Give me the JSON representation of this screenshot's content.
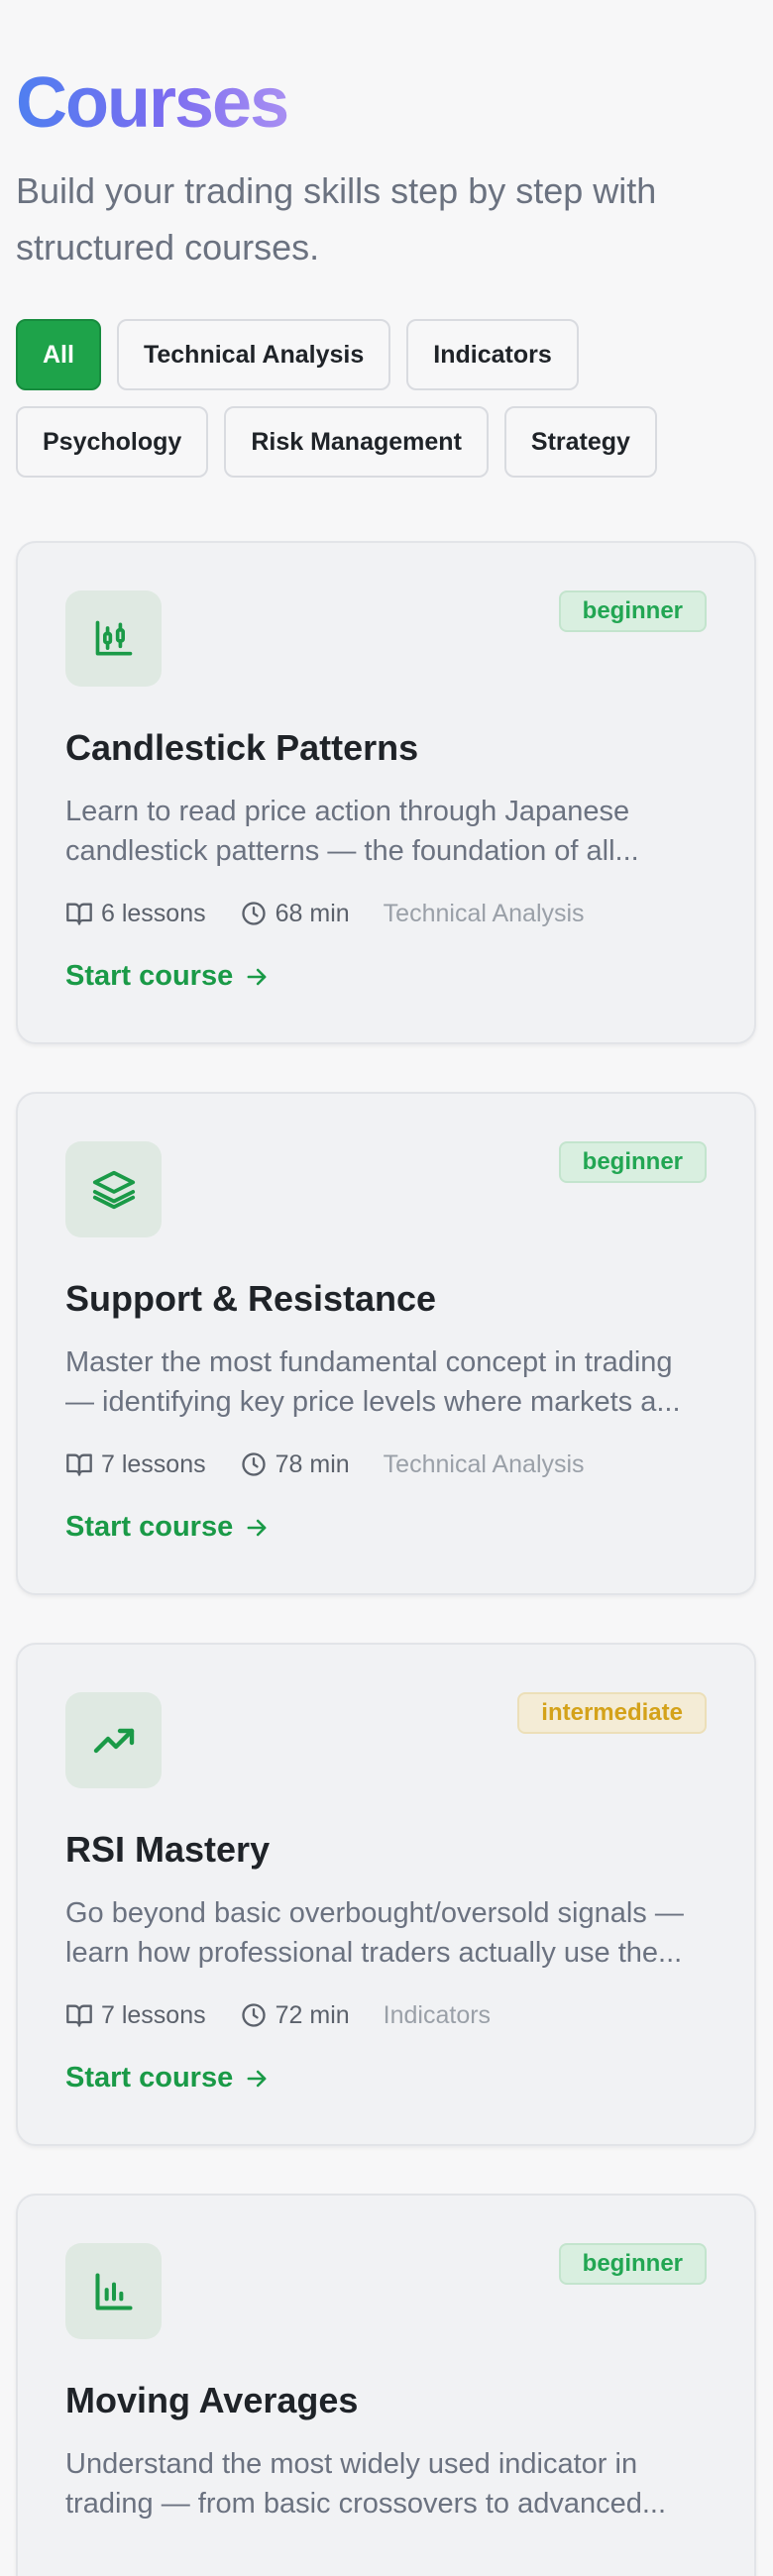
{
  "header": {
    "title": "Courses",
    "subtitle": "Build your trading skills step by step with structured courses."
  },
  "filters": [
    {
      "label": "All",
      "active": true
    },
    {
      "label": "Technical Analysis",
      "active": false
    },
    {
      "label": "Indicators",
      "active": false
    },
    {
      "label": "Psychology",
      "active": false
    },
    {
      "label": "Risk Management",
      "active": false
    },
    {
      "label": "Strategy",
      "active": false
    }
  ],
  "courses": [
    {
      "icon": "candlestick-icon",
      "level": "beginner",
      "title": "Candlestick Patterns",
      "description": "Learn to read price action through Japanese candlestick patterns — the foundation of all...",
      "lessons": "6 lessons",
      "duration": "68 min",
      "category": "Technical Analysis",
      "cta": "Start course"
    },
    {
      "icon": "layers-icon",
      "level": "beginner",
      "title": "Support & Resistance",
      "description": "Master the most fundamental concept in trading — identifying key price levels where markets a...",
      "lessons": "7 lessons",
      "duration": "78 min",
      "category": "Technical Analysis",
      "cta": "Start course"
    },
    {
      "icon": "trending-up-icon",
      "level": "intermediate",
      "title": "RSI Mastery",
      "description": "Go beyond basic overbought/oversold signals — learn how professional traders actually use the...",
      "lessons": "7 lessons",
      "duration": "72 min",
      "category": "Indicators",
      "cta": "Start course"
    },
    {
      "icon": "bar-chart-icon",
      "level": "beginner",
      "title": "Moving Averages",
      "description": "Understand the most widely used indicator in trading — from basic crossovers to advanced...",
      "lessons": "",
      "duration": "",
      "category": "",
      "cta": ""
    }
  ],
  "colors": {
    "accent": "#1ea34a",
    "beginner": "#22a653",
    "intermediate": "#d4a21a",
    "title_gradient_start": "#4f7ff0",
    "title_gradient_end": "#a88ff2"
  }
}
